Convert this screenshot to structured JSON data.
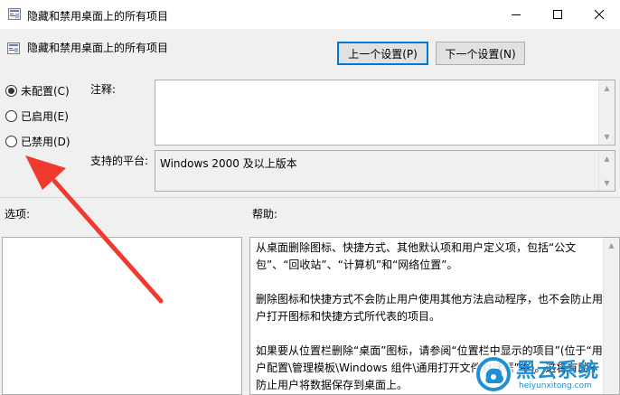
{
  "window": {
    "title": "隐藏和禁用桌面上的所有项目",
    "minimize_icon": "minimize-icon",
    "maximize_icon": "maximize-icon",
    "close_icon": "close-icon"
  },
  "header": {
    "policy_name": "隐藏和禁用桌面上的所有项目",
    "policy_icon": "policy-settings-icon"
  },
  "nav": {
    "prev_label": "上一个设置(P)",
    "next_label": "下一个设置(N)"
  },
  "state": {
    "options": [
      {
        "label": "未配置(C)",
        "selected": true
      },
      {
        "label": "已启用(E)",
        "selected": false
      },
      {
        "label": "已禁用(D)",
        "selected": false
      }
    ]
  },
  "comment": {
    "label": "注释:",
    "value": ""
  },
  "platform": {
    "label": "支持的平台:",
    "value": "Windows 2000 及以上版本"
  },
  "sections": {
    "options_label": "选项:",
    "help_label": "帮助:"
  },
  "help": {
    "paragraphs": [
      "从桌面删除图标、快捷方式、其他默认项和用户定义项，包括“公文包”、“回收站”、“计算机”和“网络位置”。",
      "删除图标和快捷方式不会防止用户使用其他方法启动程序，也不会防止用户打开图标和快捷方式所代表的项目。",
      "如果要从位置栏删除“桌面”图标，请参阅“位置栏中显示的项目”(位于“用户配置\\管理模板\\Windows 组件\\通用打开文件对话框”中)。这将有助于防止用户将数据保存到桌面上。"
    ]
  },
  "watermark": {
    "title": "黑云系统",
    "url": "heiyunxitong.com"
  },
  "annotation": {
    "arrow_color": "#f03a2e"
  }
}
